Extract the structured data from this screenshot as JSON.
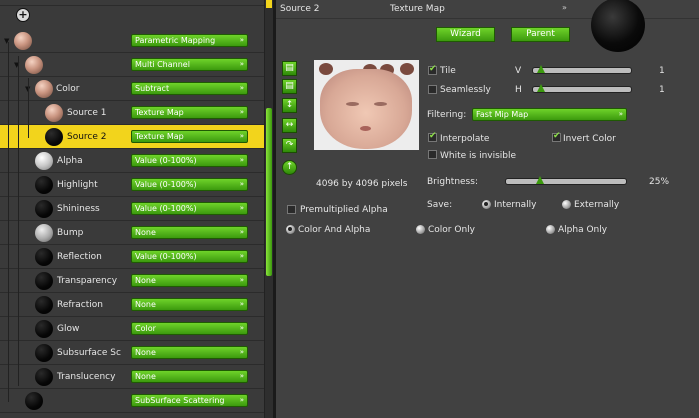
{
  "tree": {
    "rows": [
      {
        "label": "Parametric Mapping",
        "dd": "Parametric Mapping",
        "name": "",
        "ball": "skin"
      },
      {
        "label": "",
        "dd": "Multi Channel",
        "ball": "skin"
      },
      {
        "label": "Color",
        "dd": "Subtract",
        "ball": "skin"
      },
      {
        "label": "Source 1",
        "dd": "Texture Map",
        "ball": "skin"
      },
      {
        "label": "Source 2",
        "dd": "Texture Map",
        "ball": "black"
      },
      {
        "label": "Alpha",
        "dd": "Value (0-100%)",
        "ball": "white"
      },
      {
        "label": "Highlight",
        "dd": "Value (0-100%)",
        "ball": "blk2"
      },
      {
        "label": "Shininess",
        "dd": "Value (0-100%)",
        "ball": "blk2"
      },
      {
        "label": "Bump",
        "dd": "None",
        "ball": "grey"
      },
      {
        "label": "Reflection",
        "dd": "Value (0-100%)",
        "ball": "blk2"
      },
      {
        "label": "Transparency",
        "dd": "None",
        "ball": "blk2"
      },
      {
        "label": "Refraction",
        "dd": "None",
        "ball": "blk2"
      },
      {
        "label": "Glow",
        "dd": "Color",
        "ball": "blk2"
      },
      {
        "label": "Subsurface Sc",
        "dd": "None",
        "ball": "blk2"
      },
      {
        "label": "Translucency",
        "dd": "None",
        "ball": "blk2"
      },
      {
        "label": "",
        "dd": "SubSurface Scattering",
        "ball": "blk2"
      }
    ]
  },
  "panel": {
    "title": "Source 2",
    "type": "Texture Map",
    "wizard": "Wizard",
    "parent": "Parent",
    "tile": "Tile",
    "seamlessly": "Seamlessly",
    "v_label": "V",
    "h_label": "H",
    "v_value": "1",
    "h_value": "1",
    "filtering_label": "Filtering:",
    "filtering_value": "Fast Mip Map",
    "interpolate": "Interpolate",
    "invert_color": "Invert Color",
    "white_invisible": "White is invisible",
    "resolution": "4096 by 4096 pixels",
    "brightness_label": "Brightness:",
    "brightness_value": "25%",
    "save_label": "Save:",
    "internally": "Internally",
    "externally": "Externally",
    "premultiplied": "Premultiplied Alpha",
    "color_and_alpha": "Color And Alpha",
    "color_only": "Color Only",
    "alpha_only": "Alpha Only",
    "brightness_fraction": 0.25
  }
}
